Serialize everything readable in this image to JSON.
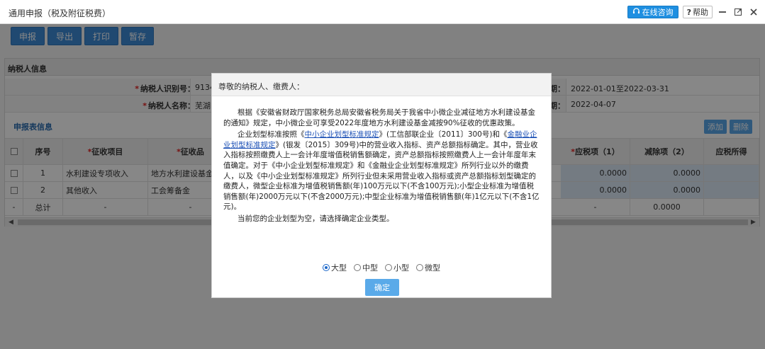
{
  "window": {
    "title": "通用申报（税及附征税费）",
    "consult_label": "在线咨询",
    "help_label": "帮助"
  },
  "toolbar": {
    "buttons": [
      "申报",
      "导出",
      "打印",
      "暂存"
    ]
  },
  "taxpayer_panel": {
    "title": "纳税人信息",
    "id_label": "纳税人识别号：",
    "id_value": "9134",
    "name_label": "纳税人名称：",
    "name_value": "芜湖",
    "period_label": "期：",
    "period_value": "2022-01-01至2022-03-31",
    "date_label": "期：",
    "date_value": "2022-04-07"
  },
  "form_section": {
    "title": "申报表信息",
    "add_label": "添加",
    "delete_label": "删除"
  },
  "table": {
    "headers": [
      "序号",
      "征收项目",
      "征收品",
      "应税项（1）",
      "减除项（2）",
      "应税所得"
    ],
    "rows": [
      {
        "seq": "1",
        "item": "水利建设专项收入",
        "sub": "地方水利建设基金",
        "taxable": "0.0000",
        "deduct": "0.0000"
      },
      {
        "seq": "2",
        "item": "其他收入",
        "sub": "工会筹备金",
        "taxable": "0.0000",
        "deduct": "0.0000"
      }
    ],
    "total": {
      "cb": "-",
      "seq": "总计",
      "item": "-",
      "sub": "-",
      "taxable": "-",
      "deduct": "0.0000"
    }
  },
  "modal": {
    "title": "尊敬的纳税人、缴费人：",
    "p1": "根据《安徽省财政厅国家税务总局安徽省税务局关于我省中小微企业减征地方水利建设基金的通知》规定，中小微企业可享受2022年度地方水利建设基金减按90%征收的优惠政策。",
    "p2_a": "企业划型标准按照《",
    "p2_link1": "中小企业划型标准规定",
    "p2_b": "》(工信部联企业〔2011〕300号)和《",
    "p2_link2": "金融业企业划型标准规定",
    "p2_c": "》(银发〔2015〕309号)中的营业收入指标、资产总额指标确定。其中，营业收入指标按照缴费人上一会计年度增值税销售额确定，资产总额指标按照缴费人上一会计年度年末值确定。对于《中小企业划型标准规定》和《金融业企业划型标准规定》所列行业以外的缴费人，以及《中小企业划型标准规定》所列行业但未采用营业收入指标或资产总额指标划型确定的缴费人，微型企业标准为增值税销售额(年)100万元以下(不含100万元);小型企业标准为增值税销售额(年)2000万元以下(不含2000万元);中型企业标准为增值税销售额(年)1亿元以下(不含1亿元)。",
    "p3": "当前您的企业划型为空，请选择确定企业类型。",
    "options": [
      "大型",
      "中型",
      "小型",
      "微型"
    ],
    "selected_option": "大型",
    "confirm_label": "确定"
  }
}
